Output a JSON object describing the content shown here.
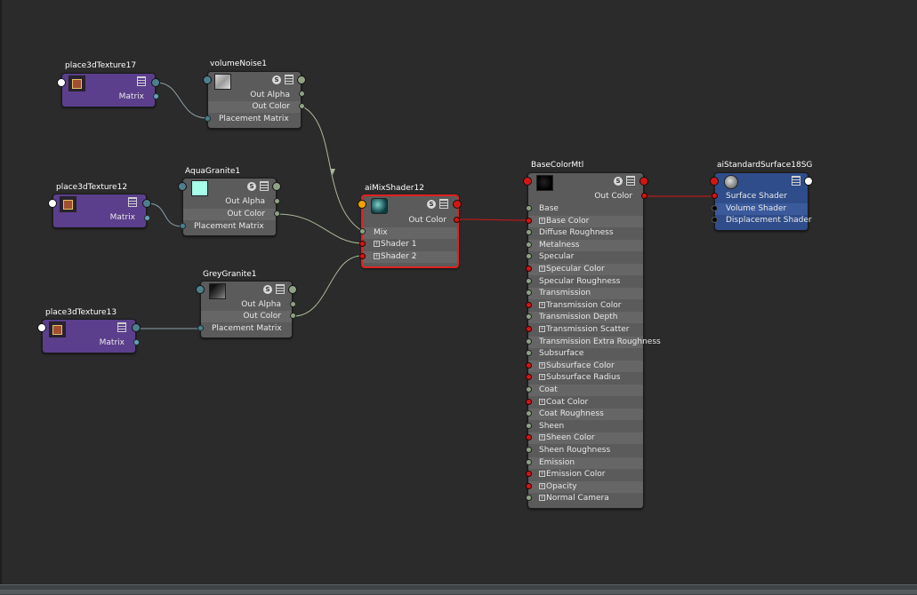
{
  "nodes": {
    "place3dTexture17": {
      "title": "place3dTexture17",
      "out": "Matrix"
    },
    "volumeNoise1": {
      "title": "volumeNoise1",
      "outs": [
        "Out Alpha",
        "Out Color"
      ],
      "in": "Placement Matrix"
    },
    "place3dTexture12": {
      "title": "place3dTexture12",
      "out": "Matrix"
    },
    "aquaGranite1": {
      "title": "AquaGranite1",
      "outs": [
        "Out Alpha",
        "Out Color"
      ],
      "in": "Placement Matrix"
    },
    "greyGranite1": {
      "title": "GreyGranite1",
      "outs": [
        "Out Alpha",
        "Out Color"
      ],
      "in": "Placement Matrix"
    },
    "place3dTexture13": {
      "title": "place3dTexture13",
      "out": "Matrix"
    },
    "aiMixShader12": {
      "title": "aiMixShader12",
      "out": "Out Color",
      "ins": [
        "Mix",
        "Shader 1",
        "Shader 2"
      ]
    },
    "baseColorMtl": {
      "title": "BaseColorMtl",
      "out": "Out Color",
      "ins": [
        "Base",
        "Base Color",
        "Diffuse Roughness",
        "Metalness",
        "Specular",
        "Specular Color",
        "Specular Roughness",
        "Transmission",
        "Transmission Color",
        "Transmission Depth",
        "Transmission Scatter",
        "Transmission Extra Roughness",
        "Subsurface",
        "Subsurface Color",
        "Subsurface Radius",
        "Coat",
        "Coat Color",
        "Coat Roughness",
        "Sheen",
        "Sheen Color",
        "Sheen Roughness",
        "Emission",
        "Emission Color",
        "Opacity",
        "Normal Camera"
      ]
    },
    "aiStandardSurface18SG": {
      "title": "aiStandardSurface18SG",
      "ins": [
        "Surface Shader",
        "Volume Shader",
        "Displacement Shader"
      ]
    }
  },
  "icons": {
    "s_icon": "S",
    "expand": "+"
  },
  "colors": {
    "background": "#2b2b2b",
    "selected_border": "#e02020",
    "wire_default": "#aab89a",
    "wire_red": "#d41515"
  }
}
